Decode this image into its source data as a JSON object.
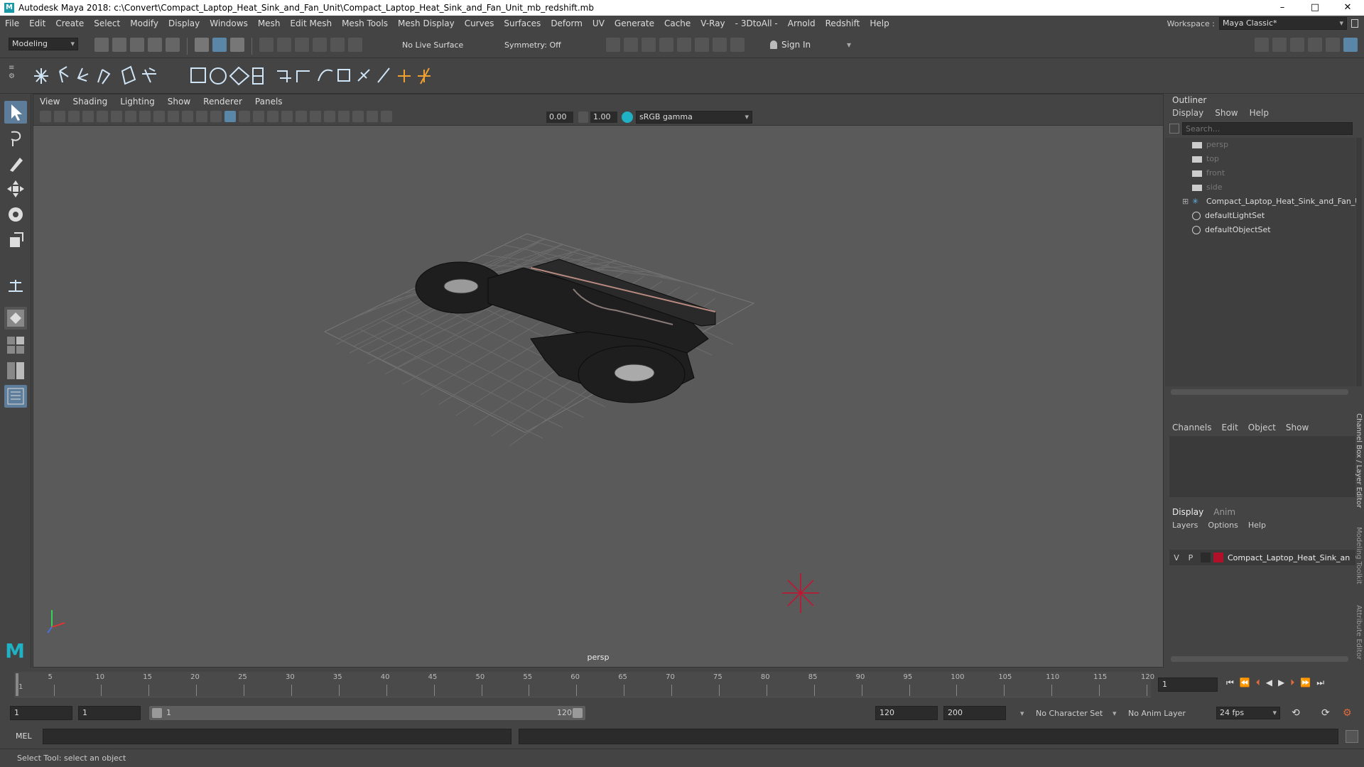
{
  "window": {
    "title": "Autodesk Maya 2018: c:\\Convert\\Compact_Laptop_Heat_Sink_and_Fan_Unit\\Compact_Laptop_Heat_Sink_and_Fan_Unit_mb_redshift.mb",
    "minimize": "–",
    "maximize": "□",
    "close": "✕"
  },
  "menubar": {
    "items": [
      "File",
      "Edit",
      "Create",
      "Select",
      "Modify",
      "Display",
      "Windows",
      "Mesh",
      "Edit Mesh",
      "Mesh Tools",
      "Mesh Display",
      "Curves",
      "Surfaces",
      "Deform",
      "UV",
      "Generate",
      "Cache",
      "V-Ray",
      "- 3DtoAll -",
      "Arnold",
      "Redshift",
      "Help"
    ],
    "workspace_label": "Workspace :",
    "workspace_value": "Maya Classic*"
  },
  "statusline": {
    "mode": "Modeling",
    "live_surface": "No Live Surface",
    "symmetry": "Symmetry: Off",
    "sign_in": "Sign In"
  },
  "viewport": {
    "menu": [
      "View",
      "Shading",
      "Lighting",
      "Show",
      "Renderer",
      "Panels"
    ],
    "exposure": "0.00",
    "gamma": "1.00",
    "color_space": "sRGB gamma",
    "camera_label": "persp"
  },
  "outliner": {
    "title": "Outliner",
    "menu": [
      "Display",
      "Show",
      "Help"
    ],
    "search_placeholder": "Search...",
    "items": [
      {
        "label": "persp",
        "dim": true
      },
      {
        "label": "top",
        "dim": true
      },
      {
        "label": "front",
        "dim": true
      },
      {
        "label": "side",
        "dim": true
      },
      {
        "label": "Compact_Laptop_Heat_Sink_and_Fan_U",
        "dim": false
      },
      {
        "label": "defaultLightSet",
        "dim": false
      },
      {
        "label": "defaultObjectSet",
        "dim": false
      }
    ]
  },
  "channelbox": {
    "menu": [
      "Channels",
      "Edit",
      "Object",
      "Show"
    ],
    "side_tab_1": "Channel Box / Layer Editor",
    "side_tab_2": "Modeling Toolkit",
    "side_tab_3": "Attribute Editor"
  },
  "layers": {
    "tabs": [
      "Display",
      "Anim"
    ],
    "menu": [
      "Layers",
      "Options",
      "Help"
    ],
    "row": {
      "v": "V",
      "p": "P",
      "name": "Compact_Laptop_Heat_Sink_an",
      "color": "#b0102a"
    }
  },
  "timeline": {
    "ticks": [
      "1",
      "5",
      "10",
      "15",
      "20",
      "25",
      "30",
      "35",
      "40",
      "45",
      "50",
      "55",
      "60",
      "65",
      "70",
      "75",
      "80",
      "85",
      "90",
      "95",
      "100",
      "105",
      "110",
      "115",
      "120"
    ],
    "current_frame": "1"
  },
  "range": {
    "start": "1",
    "anim_start": "1",
    "slider_start": "1",
    "slider_end": "120",
    "end": "120",
    "anim_end": "200",
    "character_set": "No Character Set",
    "anim_layer": "No Anim Layer",
    "fps": "24 fps"
  },
  "mel": {
    "label": "MEL"
  },
  "help": {
    "text": "Select Tool: select an object"
  }
}
